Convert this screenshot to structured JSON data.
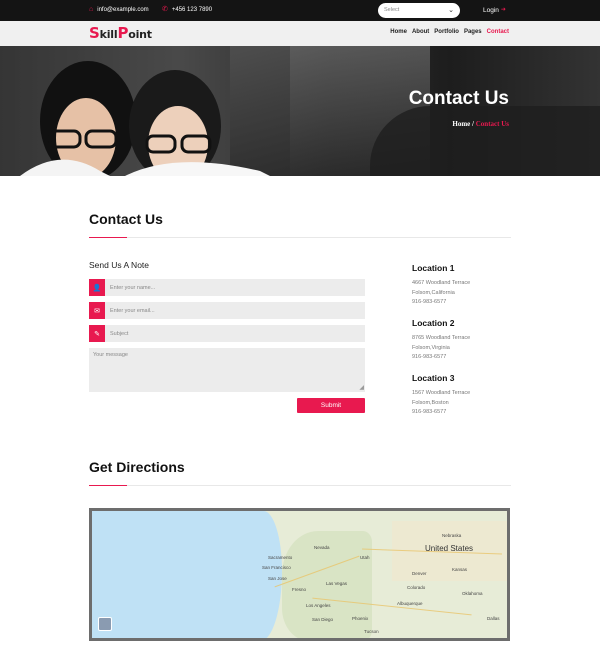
{
  "topbar": {
    "email": "info@example.com",
    "phone": "+456 123 7890",
    "select_value": "Select",
    "login_label": "Login"
  },
  "brand": {
    "first": "S",
    "part1": "kill",
    "p": "P",
    "part2": "oint"
  },
  "menu": [
    "Home",
    "About",
    "Portfolio",
    "Pages",
    "Contact"
  ],
  "hero": {
    "title": "Contact Us",
    "breadcrumb_home": "Home",
    "breadcrumb_sep": "/",
    "breadcrumb_current": "Contact Us"
  },
  "contact": {
    "title": "Contact Us",
    "note_title": "Send Us A Note",
    "name_placeholder": "Enter your name...",
    "email_placeholder": "Enter your email...",
    "subject_placeholder": "Subject",
    "message_placeholder": "Your message",
    "submit_label": "Submit"
  },
  "locations": [
    {
      "title": "Location 1",
      "street": "4667 Woodland Terrace",
      "city": "Folsom,California",
      "phone": "916-983-6577"
    },
    {
      "title": "Location 2",
      "street": "8765 Woodland Terrace",
      "city": "Folsom,Virginia",
      "phone": "916-983-6577"
    },
    {
      "title": "Location 3",
      "street": "1567 Woodland Terrace",
      "city": "Folsom,Boston",
      "phone": "916-983-6577"
    }
  ],
  "directions": {
    "title": "Get Directions"
  },
  "map": {
    "country": "United States",
    "cities": [
      "Sacramento",
      "San Francisco",
      "San Jose",
      "Las Vegas",
      "Los Angeles",
      "San Diego",
      "Phoenix",
      "Tucson",
      "Denver",
      "Dallas",
      "Albuquerque",
      "Nevada",
      "Utah",
      "Colorado",
      "Kansas",
      "Oklahoma",
      "Nebraska",
      "Fresno"
    ]
  },
  "colors": {
    "accent": "#e8194f",
    "topbar": "#141414"
  }
}
